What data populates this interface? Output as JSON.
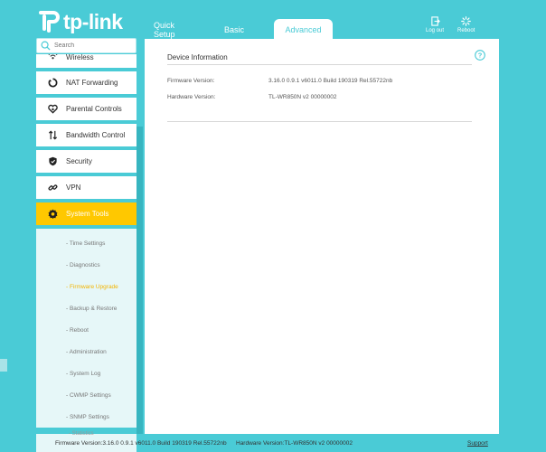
{
  "brand": {
    "logo_text": "tp-link"
  },
  "tabs": [
    {
      "label": "Quick Setup"
    },
    {
      "label": "Basic"
    },
    {
      "label": "Advanced",
      "active": true
    }
  ],
  "header_actions": {
    "logout_label": "Log out",
    "reboot_label": "Reboot"
  },
  "search": {
    "placeholder": "Search"
  },
  "sidebar": {
    "items": [
      {
        "label": "Wireless",
        "icon": "wireless-icon"
      },
      {
        "label": "NAT Forwarding",
        "icon": "nat-forwarding-icon"
      },
      {
        "label": "Parental Controls",
        "icon": "parental-controls-icon"
      },
      {
        "label": "Bandwidth Control",
        "icon": "bandwidth-control-icon"
      },
      {
        "label": "Security",
        "icon": "shield-icon"
      },
      {
        "label": "VPN",
        "icon": "vpn-icon"
      },
      {
        "label": "System Tools",
        "icon": "gear-icon",
        "active": true
      }
    ],
    "subitems": [
      {
        "label": "- Time Settings"
      },
      {
        "label": "- Diagnostics"
      },
      {
        "label": "- Firmware Upgrade",
        "active": true
      },
      {
        "label": "- Backup & Restore"
      },
      {
        "label": "- Reboot"
      },
      {
        "label": "- Administration"
      },
      {
        "label": "- System Log"
      },
      {
        "label": "- CWMP Settings"
      },
      {
        "label": "- SNMP Settings"
      },
      {
        "label": "- Statistics"
      }
    ]
  },
  "main": {
    "section_title": "Device Information",
    "rows": [
      {
        "label": "Firmware Version:",
        "value": "3.16.0 0.9.1 v6011.0 Build 190319 Rel.55722nb"
      },
      {
        "label": "Hardware Version:",
        "value": "TL-WR850N v2 00000002"
      }
    ]
  },
  "footer": {
    "firmware": "Firmware Version:3.16.0 0.9.1 v6011.0 Build 190319 Rel.55722nb",
    "hardware": "Hardware Version:TL-WR850N v2 00000002",
    "support": "Support"
  },
  "colors": {
    "accent": "#4acbd6",
    "active": "#ffc800",
    "sub_active": "#f3b400"
  }
}
